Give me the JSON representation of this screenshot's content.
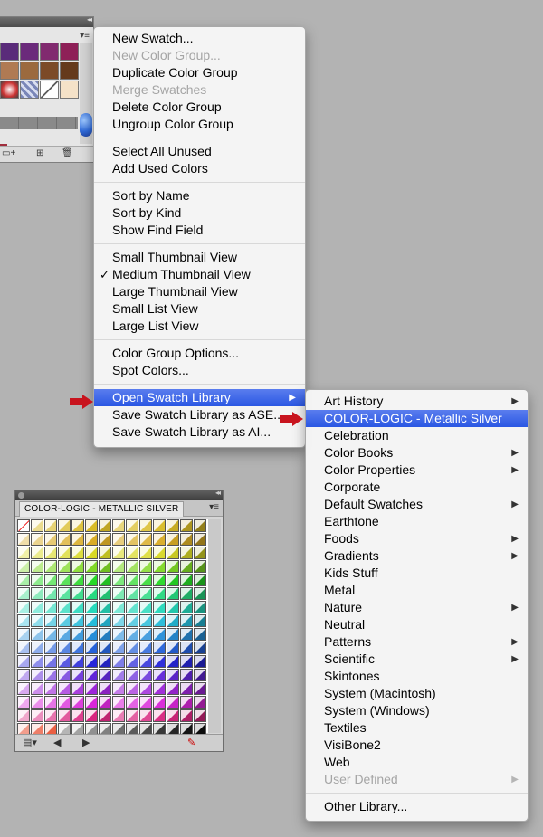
{
  "main_menu": {
    "groups": [
      [
        {
          "label": "New Swatch...",
          "enabled": true
        },
        {
          "label": "New Color Group...",
          "enabled": false
        },
        {
          "label": "Duplicate Color Group",
          "enabled": true
        },
        {
          "label": "Merge Swatches",
          "enabled": false
        },
        {
          "label": "Delete Color Group",
          "enabled": true
        },
        {
          "label": "Ungroup Color Group",
          "enabled": true
        }
      ],
      [
        {
          "label": "Select All Unused",
          "enabled": true
        },
        {
          "label": "Add Used Colors",
          "enabled": true
        }
      ],
      [
        {
          "label": "Sort by Name",
          "enabled": true
        },
        {
          "label": "Sort by Kind",
          "enabled": true
        },
        {
          "label": "Show Find Field",
          "enabled": true
        }
      ],
      [
        {
          "label": "Small Thumbnail View",
          "enabled": true
        },
        {
          "label": "Medium Thumbnail View",
          "enabled": true,
          "checked": true
        },
        {
          "label": "Large Thumbnail View",
          "enabled": true
        },
        {
          "label": "Small List View",
          "enabled": true
        },
        {
          "label": "Large List View",
          "enabled": true
        }
      ],
      [
        {
          "label": "Color Group Options...",
          "enabled": true
        },
        {
          "label": "Spot Colors...",
          "enabled": true
        }
      ],
      [
        {
          "label": "Open Swatch Library",
          "enabled": true,
          "submenu": true,
          "highlighted": true
        },
        {
          "label": "Save Swatch Library as ASE...",
          "enabled": true
        },
        {
          "label": "Save Swatch Library as AI...",
          "enabled": true
        }
      ]
    ]
  },
  "library_submenu": {
    "groups": [
      [
        {
          "label": "Art History",
          "submenu": true
        },
        {
          "label": "COLOR-LOGIC - Metallic Silver",
          "highlighted": true
        },
        {
          "label": "Celebration"
        },
        {
          "label": "Color Books",
          "submenu": true
        },
        {
          "label": "Color Properties",
          "submenu": true
        },
        {
          "label": "Corporate"
        },
        {
          "label": "Default Swatches",
          "submenu": true
        },
        {
          "label": "Earthtone"
        },
        {
          "label": "Foods",
          "submenu": true
        },
        {
          "label": "Gradients",
          "submenu": true
        },
        {
          "label": "Kids Stuff"
        },
        {
          "label": "Metal"
        },
        {
          "label": "Nature",
          "submenu": true
        },
        {
          "label": "Neutral"
        },
        {
          "label": "Patterns",
          "submenu": true
        },
        {
          "label": "Scientific",
          "submenu": true
        },
        {
          "label": "Skintones"
        },
        {
          "label": "System (Macintosh)"
        },
        {
          "label": "System (Windows)"
        },
        {
          "label": "Textiles"
        },
        {
          "label": "VisiBone2"
        },
        {
          "label": "Web"
        },
        {
          "label": "User Defined",
          "submenu": true,
          "enabled": false
        }
      ],
      [
        {
          "label": "Other Library..."
        }
      ]
    ]
  },
  "metallic_panel": {
    "tab_label": "COLOR-LOGIC - METALLIC SILVER"
  },
  "icons": {
    "menu_checkmark": "checkmark-icon",
    "submenu_arrow": "submenu-arrow-icon",
    "pointer": "red-arrow-icon"
  },
  "colors": {
    "highlight": "#2a57e3",
    "pointer_red": "#c8141e",
    "background": "#b3b3b3"
  }
}
